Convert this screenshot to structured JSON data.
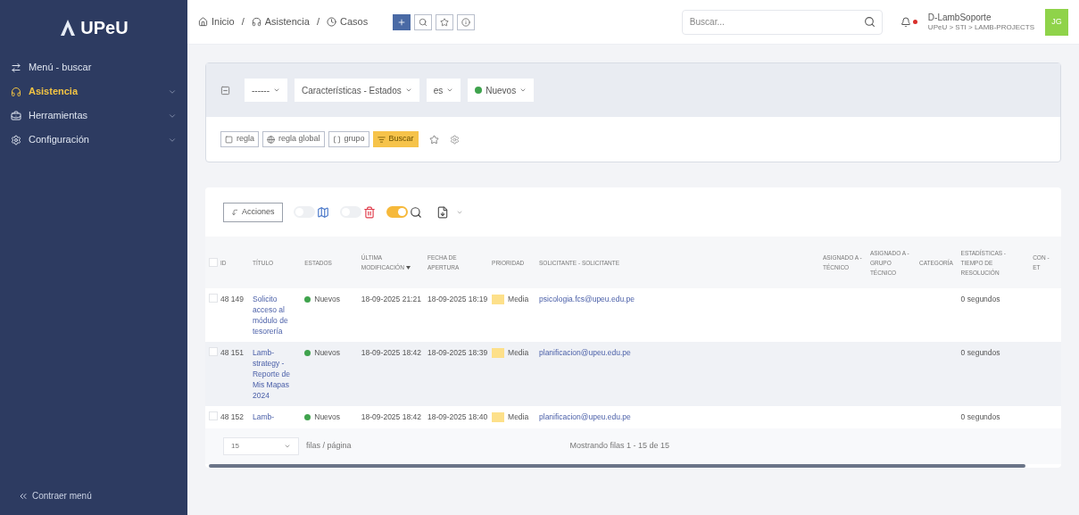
{
  "sidebar": {
    "logo": "UPeU",
    "items": [
      {
        "label": "Menú - buscar",
        "selected": false,
        "expandable": false
      },
      {
        "label": "Asistencia",
        "selected": true,
        "expandable": true
      },
      {
        "label": "Herramientas",
        "selected": false,
        "expandable": true
      },
      {
        "label": "Configuración",
        "selected": false,
        "expandable": true
      }
    ],
    "collapse": "Contraer menú"
  },
  "header": {
    "breadcrumb": [
      {
        "label": "Inicio"
      },
      {
        "label": "Asistencia"
      },
      {
        "label": "Casos"
      }
    ],
    "separator": "/",
    "tools": [
      {
        "primary": true
      },
      {
        "primary": false
      },
      {
        "primary": false
      },
      {
        "primary": false
      }
    ],
    "search": {
      "placeholder": "Buscar..."
    },
    "notifications": true,
    "user": {
      "name": "D-LambSoporte",
      "path": "UPeU > STI > LAMB-PROJECTS",
      "initials": "JG"
    }
  },
  "filter": {
    "criteria": [
      {
        "label": "------"
      },
      {
        "label": "Características - Estados"
      },
      {
        "label": "es"
      },
      {
        "label": "Nuevos",
        "color": "#3fa34d"
      }
    ],
    "actions": [
      {
        "label": "regla",
        "primary": false
      },
      {
        "label": "regla global",
        "primary": false
      },
      {
        "label": "grupo",
        "primary": false
      },
      {
        "label": "Buscar",
        "primary": true
      }
    ]
  },
  "table_toolbar": {
    "actions_label": "Acciones",
    "toggles": [
      {
        "on": false
      },
      {
        "on": false
      },
      {
        "on": true
      }
    ]
  },
  "table": {
    "all_checked": false,
    "columns": [
      {
        "label": "ID",
        "sorted": false
      },
      {
        "label": "TÍTULO",
        "sorted": false
      },
      {
        "label": "ESTADOS",
        "sorted": false
      },
      {
        "label": "ÚLTIMA MODIFICACIÓN",
        "sorted": true
      },
      {
        "label": "FECHA DE APERTURA",
        "sorted": false
      },
      {
        "label": "PRIORIDAD",
        "sorted": false
      },
      {
        "label": "SOLICITANTE - SOLICITANTE",
        "sorted": false
      },
      {
        "label": "ASIGNADO A - TÉCNICO",
        "sorted": false
      },
      {
        "label": "ASIGNADO A - GRUPO TÉCNICO",
        "sorted": false
      },
      {
        "label": "CATEGORÍA",
        "sorted": false
      },
      {
        "label": "ESTADÍSTICAS - TIEMPO DE RESOLUCIÓN",
        "sorted": false
      },
      {
        "label": "CON - ET",
        "sorted": false
      }
    ],
    "rows": [
      {
        "checked": false,
        "id": "48 149",
        "title": "Solicito acceso al módulo de tesorería",
        "status": {
          "label": "Nuevos",
          "color": "#3fa34d"
        },
        "modified": "18-09-2025 21:21",
        "opened": "18-09-2025 18:19",
        "priority": {
          "label": "Media",
          "color": "#fde08a"
        },
        "requester": "psicologia.fcs@upeu.edu.pe",
        "resolution": "0 segundos"
      },
      {
        "checked": false,
        "id": "48 151",
        "title": "Lamb-strategy - Reporte de Mis Mapas 2024",
        "status": {
          "label": "Nuevos",
          "color": "#3fa34d"
        },
        "modified": "18-09-2025 18:42",
        "opened": "18-09-2025 18:39",
        "priority": {
          "label": "Media",
          "color": "#fde08a"
        },
        "requester": "planificacion@upeu.edu.pe",
        "resolution": "0 segundos"
      },
      {
        "checked": false,
        "id": "48 152",
        "title": "Lamb-",
        "status": {
          "label": "Nuevos",
          "color": "#3fa34d"
        },
        "modified": "18-09-2025 18:42",
        "opened": "18-09-2025 18:40",
        "priority": {
          "label": "Media",
          "color": "#fde08a"
        },
        "requester": "planificacion@upeu.edu.pe",
        "resolution": "0 segundos"
      }
    ]
  },
  "pagination": {
    "page_size": "15",
    "page_size_label": "filas / página",
    "summary": "Mostrando filas 1 - 15 de 15"
  }
}
